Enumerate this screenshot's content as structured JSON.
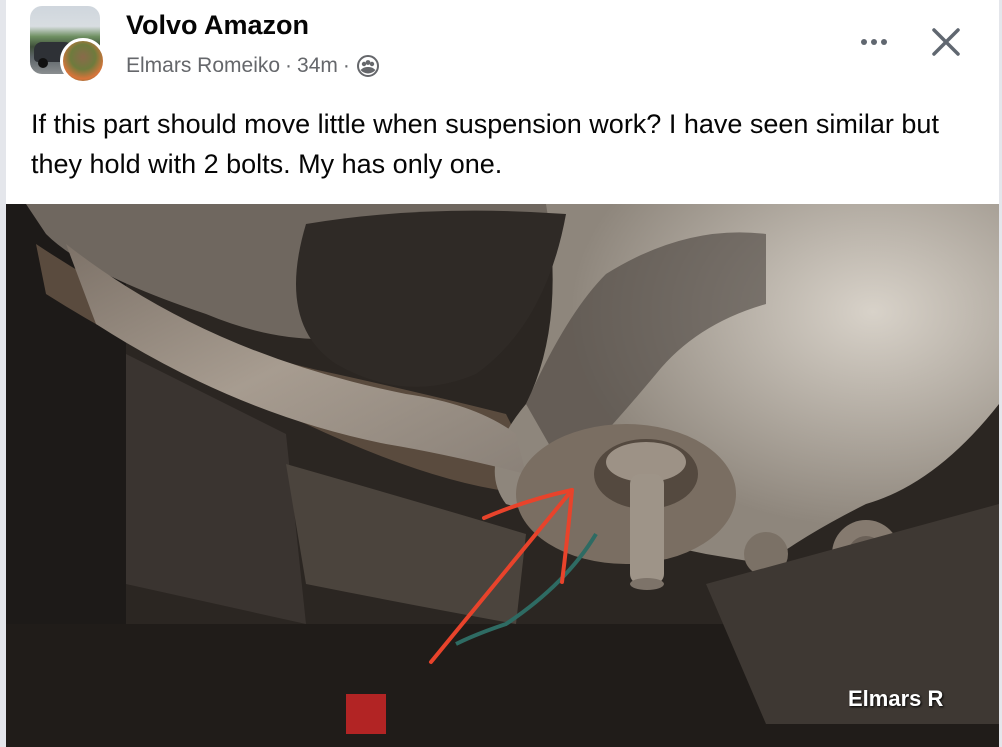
{
  "group": {
    "name": "Volvo Amazon",
    "avatar_icon": "group-car-photo",
    "member_avatar_icon": "user-profile-photo"
  },
  "post": {
    "author": "Elmars Romeiko",
    "separator": "·",
    "time": "34m",
    "privacy_icon": "group-members-icon",
    "text": "If this part should move little when suspension work? I have seen similar but they hold with 2 bolts. My has only one.",
    "more_icon": "more-options-icon",
    "close_icon": "close-icon"
  },
  "photo": {
    "watermark": "Elmars R",
    "annotation_color": "#e8432b"
  }
}
